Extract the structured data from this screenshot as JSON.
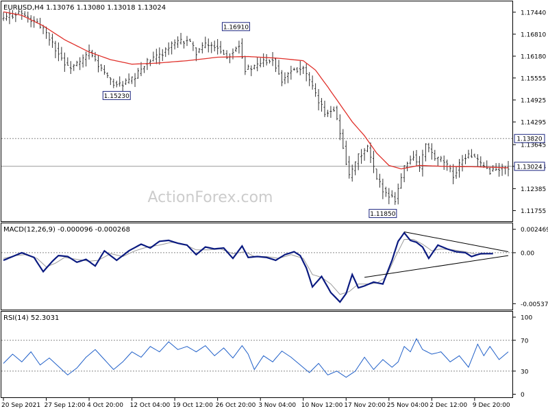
{
  "colors": {
    "price": "#2f2f2f",
    "ma": "#e0302a",
    "macd": "#0a1a80",
    "signal": "#999999",
    "rsi": "#1f5fc8",
    "level_box": "#1a237e",
    "watermark": "#cccccc",
    "grid_dash": "#888888"
  },
  "watermark": "ActionForex.com",
  "chart_data": [
    {
      "type": "line",
      "panel": "price",
      "title": "EURUSD,H4  1.13076 1.13080 1.13018 1.13024",
      "ylim": [
        1.1145,
        1.1775
      ],
      "y_ticks": [
        "1.17440",
        "1.16810",
        "1.16180",
        "1.15555",
        "1.14925",
        "1.14295",
        "1.13645",
        "1.13024",
        "1.12385",
        "1.11755"
      ],
      "y_tick_values": [
        1.1744,
        1.1681,
        1.1618,
        1.15555,
        1.14925,
        1.14295,
        1.13645,
        1.13024,
        1.12385,
        1.11755
      ],
      "x_ticks": [
        "20 Sep 2021",
        "27 Sep 12:00",
        "4 Oct 20:00",
        "12 Oct 04:00",
        "19 Oct 12:00",
        "26 Oct 20:00",
        "3 Nov 04:00",
        "10 Nov 12:00",
        "17 Nov 20:00",
        "25 Nov 04:00",
        "2 Dec 12:00",
        "9 Dec 20:00"
      ],
      "x_tick_index": [
        0,
        14,
        28,
        42,
        56,
        70,
        84,
        98,
        112,
        126,
        140,
        154
      ],
      "bars_count": 166,
      "current_price": "1.13024",
      "current_value": 1.13024,
      "horizontal_level": "1.13820",
      "horizontal_value": 1.1382,
      "annotations": [
        {
          "label": "1.16910",
          "value": 1.1691,
          "bar": 76
        },
        {
          "label": "1.15230",
          "value": 1.1523,
          "bar": 37
        },
        {
          "label": "1.11850",
          "value": 1.1185,
          "bar": 124
        }
      ],
      "close_anchors": [
        [
          0,
          1.1725
        ],
        [
          5,
          1.1745
        ],
        [
          9,
          1.172
        ],
        [
          13,
          1.17
        ],
        [
          17,
          1.164
        ],
        [
          21,
          1.1585
        ],
        [
          25,
          1.1598
        ],
        [
          28,
          1.163
        ],
        [
          32,
          1.158
        ],
        [
          35,
          1.1545
        ],
        [
          38,
          1.1535
        ],
        [
          43,
          1.1555
        ],
        [
          46,
          1.1595
        ],
        [
          50,
          1.1615
        ],
        [
          55,
          1.165
        ],
        [
          60,
          1.1665
        ],
        [
          63,
          1.163
        ],
        [
          66,
          1.165
        ],
        [
          70,
          1.1645
        ],
        [
          73,
          1.1615
        ],
        [
          77,
          1.1655
        ],
        [
          79,
          1.158
        ],
        [
          82,
          1.1585
        ],
        [
          85,
          1.1605
        ],
        [
          88,
          1.161
        ],
        [
          91,
          1.155
        ],
        [
          94,
          1.158
        ],
        [
          98,
          1.1585
        ],
        [
          102,
          1.1505
        ],
        [
          105,
          1.1455
        ],
        [
          108,
          1.147
        ],
        [
          111,
          1.136
        ],
        [
          113,
          1.127
        ],
        [
          116,
          1.133
        ],
        [
          119,
          1.1355
        ],
        [
          122,
          1.1265
        ],
        [
          125,
          1.1225
        ],
        [
          128,
          1.121
        ],
        [
          131,
          1.13
        ],
        [
          134,
          1.1335
        ],
        [
          136,
          1.1295
        ],
        [
          138,
          1.1365
        ],
        [
          141,
          1.1325
        ],
        [
          144,
          1.1315
        ],
        [
          147,
          1.1275
        ],
        [
          150,
          1.1325
        ],
        [
          153,
          1.1335
        ],
        [
          156,
          1.1305
        ],
        [
          159,
          1.129
        ],
        [
          162,
          1.1295
        ],
        [
          165,
          1.1302
        ]
      ],
      "ma_anchors": [
        [
          0,
          1.1745
        ],
        [
          6,
          1.1735
        ],
        [
          13,
          1.1705
        ],
        [
          20,
          1.1665
        ],
        [
          28,
          1.163
        ],
        [
          35,
          1.1608
        ],
        [
          42,
          1.1595
        ],
        [
          50,
          1.1598
        ],
        [
          60,
          1.1605
        ],
        [
          70,
          1.1615
        ],
        [
          80,
          1.1617
        ],
        [
          90,
          1.1612
        ],
        [
          98,
          1.1605
        ],
        [
          102,
          1.1578
        ],
        [
          106,
          1.153
        ],
        [
          110,
          1.148
        ],
        [
          114,
          1.143
        ],
        [
          118,
          1.139
        ],
        [
          122,
          1.134
        ],
        [
          126,
          1.1305
        ],
        [
          130,
          1.1295
        ],
        [
          136,
          1.1305
        ],
        [
          145,
          1.1302
        ],
        [
          155,
          1.1301
        ],
        [
          165,
          1.1298
        ]
      ]
    },
    {
      "type": "line",
      "panel": "macd",
      "title": "MACD(12,26,9) -0.000096 -0.000268",
      "ylim": [
        -0.006,
        0.0031
      ],
      "y_ticks": [
        "0.002469",
        "0.00",
        "-0.005375"
      ],
      "y_tick_values": [
        0.002469,
        0.0,
        -0.005375
      ],
      "series": [
        {
          "name": "MACD",
          "anchors": [
            [
              0,
              -0.0008
            ],
            [
              3,
              -0.0004
            ],
            [
              6,
              0.0
            ],
            [
              10,
              -0.0005
            ],
            [
              13,
              -0.002
            ],
            [
              16,
              -0.0009
            ],
            [
              18,
              -0.0003
            ],
            [
              21,
              -0.0004
            ],
            [
              24,
              -0.001
            ],
            [
              27,
              -0.0007
            ],
            [
              30,
              -0.0014
            ],
            [
              33,
              0.0002
            ],
            [
              37,
              -0.0008
            ],
            [
              41,
              0.0002
            ],
            [
              45,
              0.0009
            ],
            [
              48,
              0.0005
            ],
            [
              51,
              0.0012
            ],
            [
              54,
              0.0013
            ],
            [
              57,
              0.001
            ],
            [
              60,
              0.0008
            ],
            [
              63,
              -0.0002
            ],
            [
              66,
              0.0006
            ],
            [
              69,
              0.0004
            ],
            [
              72,
              0.0005
            ],
            [
              75,
              -0.0006
            ],
            [
              78,
              0.0007
            ],
            [
              80,
              -0.0005
            ],
            [
              83,
              -0.0004
            ],
            [
              86,
              -0.0005
            ],
            [
              89,
              -0.0008
            ],
            [
              92,
              -0.0002
            ],
            [
              95,
              0.0001
            ],
            [
              97,
              -0.0003
            ],
            [
              99,
              -0.0016
            ],
            [
              101,
              -0.0036
            ],
            [
              104,
              -0.0025
            ],
            [
              107,
              -0.0042
            ],
            [
              110,
              -0.0052
            ],
            [
              112,
              -0.0043
            ],
            [
              114,
              -0.0023
            ],
            [
              116,
              -0.0037
            ],
            [
              118,
              -0.0035
            ],
            [
              121,
              -0.0031
            ],
            [
              124,
              -0.0033
            ],
            [
              127,
              -0.0008
            ],
            [
              129,
              0.0012
            ],
            [
              131,
              0.0021
            ],
            [
              133,
              0.0013
            ],
            [
              135,
              0.0011
            ],
            [
              137,
              0.0006
            ],
            [
              139,
              -0.0006
            ],
            [
              142,
              0.0008
            ],
            [
              145,
              0.0004
            ],
            [
              148,
              0.0001
            ],
            [
              151,
              0.0
            ],
            [
              153,
              -0.0004
            ],
            [
              156,
              -0.0001
            ],
            [
              160,
              -0.0001
            ]
          ]
        },
        {
          "name": "Signal",
          "anchors": [
            [
              0,
              -0.0006
            ],
            [
              4,
              -0.0003
            ],
            [
              7,
              -0.0002
            ],
            [
              11,
              -0.0006
            ],
            [
              14,
              -0.0015
            ],
            [
              17,
              -0.0011
            ],
            [
              20,
              -0.0005
            ],
            [
              24,
              -0.0007
            ],
            [
              28,
              -0.0009
            ],
            [
              31,
              -0.0008
            ],
            [
              35,
              -0.0001
            ],
            [
              39,
              -0.0004
            ],
            [
              43,
              0.0002
            ],
            [
              47,
              0.0006
            ],
            [
              51,
              0.0008
            ],
            [
              55,
              0.0011
            ],
            [
              59,
              0.0009
            ],
            [
              63,
              0.0003
            ],
            [
              67,
              0.0003
            ],
            [
              71,
              0.0004
            ],
            [
              75,
              -0.0001
            ],
            [
              79,
              0.0001
            ],
            [
              82,
              -0.0004
            ],
            [
              86,
              -0.0004
            ],
            [
              90,
              -0.0006
            ],
            [
              94,
              -0.0002
            ],
            [
              98,
              -0.0006
            ],
            [
              101,
              -0.0023
            ],
            [
              104,
              -0.0026
            ],
            [
              107,
              -0.0033
            ],
            [
              110,
              -0.0044
            ],
            [
              113,
              -0.0041
            ],
            [
              116,
              -0.0033
            ],
            [
              119,
              -0.0033
            ],
            [
              122,
              -0.0032
            ],
            [
              125,
              -0.0026
            ],
            [
              128,
              -0.0005
            ],
            [
              131,
              0.0014
            ],
            [
              134,
              0.0014
            ],
            [
              137,
              0.0009
            ],
            [
              140,
              0.0002
            ],
            [
              143,
              0.0004
            ],
            [
              147,
              0.0003
            ],
            [
              151,
              0.0001
            ],
            [
              155,
              -0.0002
            ],
            [
              160,
              -0.0001
            ]
          ]
        }
      ]
    },
    {
      "type": "line",
      "panel": "rsi",
      "title": "RSI(14) 52.3031",
      "ylim": [
        0,
        100
      ],
      "y_ticks": [
        "100",
        "70",
        "30",
        "0"
      ],
      "y_tick_values": [
        100,
        70,
        30,
        0
      ],
      "levels": [
        70,
        30
      ],
      "series": [
        {
          "name": "RSI(14)",
          "anchors": [
            [
              0,
              40
            ],
            [
              3,
              52
            ],
            [
              6,
              42
            ],
            [
              9,
              55
            ],
            [
              12,
              38
            ],
            [
              15,
              47
            ],
            [
              18,
              36
            ],
            [
              21,
              25
            ],
            [
              24,
              34
            ],
            [
              27,
              48
            ],
            [
              30,
              58
            ],
            [
              33,
              45
            ],
            [
              36,
              32
            ],
            [
              39,
              42
            ],
            [
              42,
              55
            ],
            [
              45,
              48
            ],
            [
              48,
              62
            ],
            [
              51,
              55
            ],
            [
              54,
              68
            ],
            [
              57,
              58
            ],
            [
              60,
              62
            ],
            [
              63,
              55
            ],
            [
              66,
              63
            ],
            [
              69,
              50
            ],
            [
              72,
              60
            ],
            [
              75,
              47
            ],
            [
              78,
              63
            ],
            [
              80,
              52
            ],
            [
              82,
              32
            ],
            [
              85,
              50
            ],
            [
              88,
              42
            ],
            [
              91,
              56
            ],
            [
              94,
              48
            ],
            [
              97,
              38
            ],
            [
              100,
              28
            ],
            [
              103,
              40
            ],
            [
              106,
              25
            ],
            [
              109,
              30
            ],
            [
              112,
              22
            ],
            [
              115,
              30
            ],
            [
              118,
              48
            ],
            [
              121,
              32
            ],
            [
              124,
              45
            ],
            [
              127,
              35
            ],
            [
              129,
              42
            ],
            [
              131,
              62
            ],
            [
              133,
              55
            ],
            [
              135,
              72
            ],
            [
              137,
              58
            ],
            [
              140,
              52
            ],
            [
              143,
              55
            ],
            [
              146,
              42
            ],
            [
              149,
              50
            ],
            [
              152,
              35
            ],
            [
              155,
              65
            ],
            [
              157,
              50
            ],
            [
              159,
              62
            ],
            [
              162,
              45
            ],
            [
              165,
              55
            ]
          ]
        }
      ]
    }
  ]
}
